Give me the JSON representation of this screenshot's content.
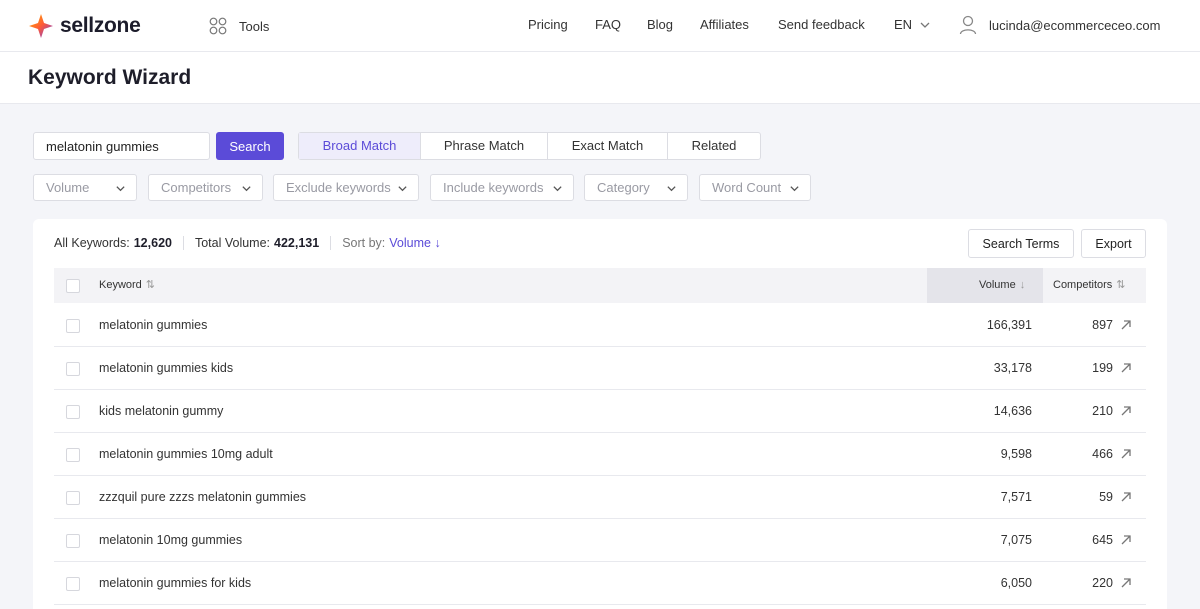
{
  "brand": {
    "name": "sellzone"
  },
  "topnav": {
    "tools_label": "Tools",
    "links": [
      "Pricing",
      "FAQ",
      "Blog",
      "Affiliates",
      "Send feedback"
    ],
    "language": "EN",
    "user_email": "lucinda@ecommerceceo.com"
  },
  "page": {
    "title": "Keyword Wizard"
  },
  "search": {
    "value": "melatonin gummies",
    "button_label": "Search"
  },
  "match_tabs": [
    {
      "label": "Broad Match",
      "active": true
    },
    {
      "label": "Phrase Match",
      "active": false
    },
    {
      "label": "Exact Match",
      "active": false
    },
    {
      "label": "Related",
      "active": false
    }
  ],
  "filters": [
    "Volume",
    "Competitors",
    "Exclude keywords",
    "Include keywords",
    "Category",
    "Word Count"
  ],
  "summary": {
    "all_keywords_label": "All Keywords:",
    "all_keywords_value": "12,620",
    "total_volume_label": "Total Volume:",
    "total_volume_value": "422,131",
    "sort_label": "Sort by:",
    "sort_value": "Volume ↓"
  },
  "actions": {
    "search_terms": "Search Terms",
    "export": "Export"
  },
  "table": {
    "headers": {
      "keyword": "Keyword",
      "volume": "Volume",
      "competitors": "Competitors"
    },
    "rows": [
      {
        "keyword": "melatonin gummies",
        "volume": "166,391",
        "competitors": "897"
      },
      {
        "keyword": "melatonin gummies kids",
        "volume": "33,178",
        "competitors": "199"
      },
      {
        "keyword": "kids melatonin gummy",
        "volume": "14,636",
        "competitors": "210"
      },
      {
        "keyword": "melatonin gummies 10mg adult",
        "volume": "9,598",
        "competitors": "466"
      },
      {
        "keyword": "zzzquil pure zzzs melatonin gummies",
        "volume": "7,571",
        "competitors": "59"
      },
      {
        "keyword": "melatonin 10mg gummies",
        "volume": "7,075",
        "competitors": "645"
      },
      {
        "keyword": "melatonin gummies for kids",
        "volume": "6,050",
        "competitors": "220"
      }
    ]
  },
  "colors": {
    "accent": "#5b4bd8",
    "accent_light": "#eeedfb",
    "background": "#f4f5f9"
  }
}
